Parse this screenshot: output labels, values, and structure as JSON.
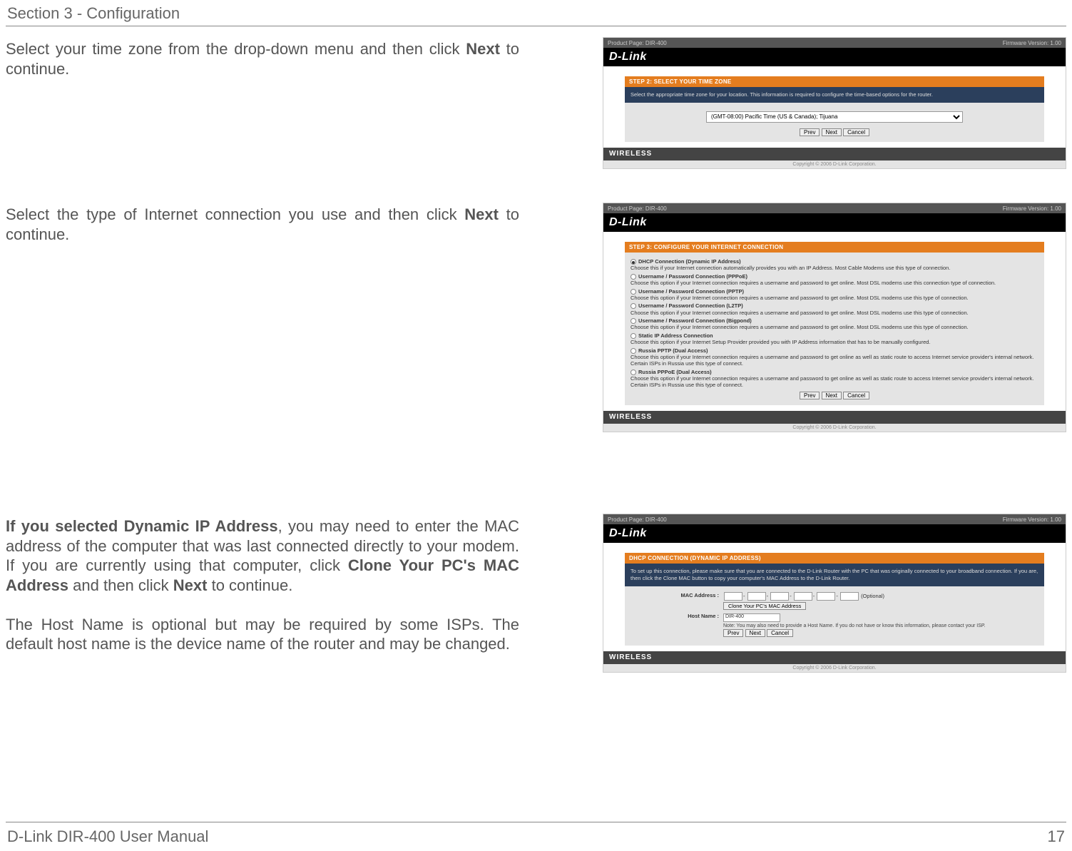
{
  "header": "Section 3 - Configuration",
  "footer_left": "D-Link DIR-400 User Manual",
  "footer_right": "17",
  "para1_a": "Select your time zone from the drop-down menu and then click ",
  "para1_b": "Next",
  "para1_c": " to continue.",
  "para2_a": "Select the type of Internet connection you use and then click ",
  "para2_b": "Next",
  "para2_c": " to continue.",
  "para3_a": "If you selected Dynamic IP Address",
  "para3_b": ", you may need to enter the MAC address of the computer that was last connected directly to your modem. If you are currently using that computer, click ",
  "para3_c": "Clone Your PC's MAC Address",
  "para3_d": " and then click ",
  "para3_e": "Next",
  "para3_f": " to continue.",
  "para4": "The Host Name is optional but may be required by some ISPs. The default host name is the device name of the router and may be changed.",
  "ss": {
    "topbar_left": "Product Page: DIR-400",
    "topbar_right": "Firmware Version: 1.00",
    "brand": "D-Link",
    "wireless": "WIRELESS",
    "copyright": "Copyright © 2006 D-Link Corporation.",
    "prev": "Prev",
    "next": "Next",
    "cancel": "Cancel"
  },
  "shot1": {
    "header": "STEP 2: SELECT YOUR TIME ZONE",
    "desc": "Select the appropriate time zone for your location. This information is required to configure the time-based options for the router.",
    "tz": "(GMT-08:00) Pacific Time (US & Canada); Tijuana"
  },
  "shot2": {
    "header": "STEP 3: CONFIGURE YOUR INTERNET CONNECTION",
    "opts": [
      {
        "title": "DHCP Connection (Dynamic IP Address)",
        "desc": "Choose this if your Internet connection automatically provides you with an IP Address. Most Cable Modems use this type of connection."
      },
      {
        "title": "Username / Password Connection (PPPoE)",
        "desc": "Choose this option if your Internet connection requires a username and password to get online. Most DSL modems use this connection type of connection."
      },
      {
        "title": "Username / Password Connection (PPTP)",
        "desc": "Choose this option if your Internet connection requires a username and password to get online. Most DSL modems use this type of connection."
      },
      {
        "title": "Username / Password Connection (L2TP)",
        "desc": "Choose this option if your Internet connection requires a username and password to get online. Most DSL modems use this type of connection."
      },
      {
        "title": "Username / Password Connection (Bigpond)",
        "desc": "Choose this option if your Internet connection requires a username and password to get online. Most DSL modems use this type of connection."
      },
      {
        "title": "Static IP Address Connection",
        "desc": "Choose this option if your Internet Setup Provider provided you with IP Address information that has to be manually configured."
      },
      {
        "title": "Russia PPTP (Dual Access)",
        "desc": "Choose this option if your Internet connection requires a username and password to get online as well as static route to access Internet service provider's internal network. Certain ISPs in Russia use this type of connect."
      },
      {
        "title": "Russia PPPoE (Dual Access)",
        "desc": "Choose this option if your Internet connection requires a username and password to get online as well as static route to access Internet service provider's internal network. Certain ISPs in Russia use this type of connect."
      }
    ]
  },
  "shot3": {
    "header": "DHCP CONNECTION (DYNAMIC IP ADDRESS)",
    "desc": "To set up this connection, please make sure that you are connected to the D-Link Router with the PC that was originally connected to your broadband connection. If you are, then click the Clone MAC button to copy your computer's MAC Address to the D-Link Router.",
    "mac_label": "MAC Address :",
    "mac_optional": "(Optional)",
    "clone_btn": "Clone Your PC's MAC Address",
    "host_label": "Host Name :",
    "host_value": "DIR-400",
    "host_note": "Note: You may also need to provide a Host Name. If you do not have or know this information, please contact your ISP."
  }
}
